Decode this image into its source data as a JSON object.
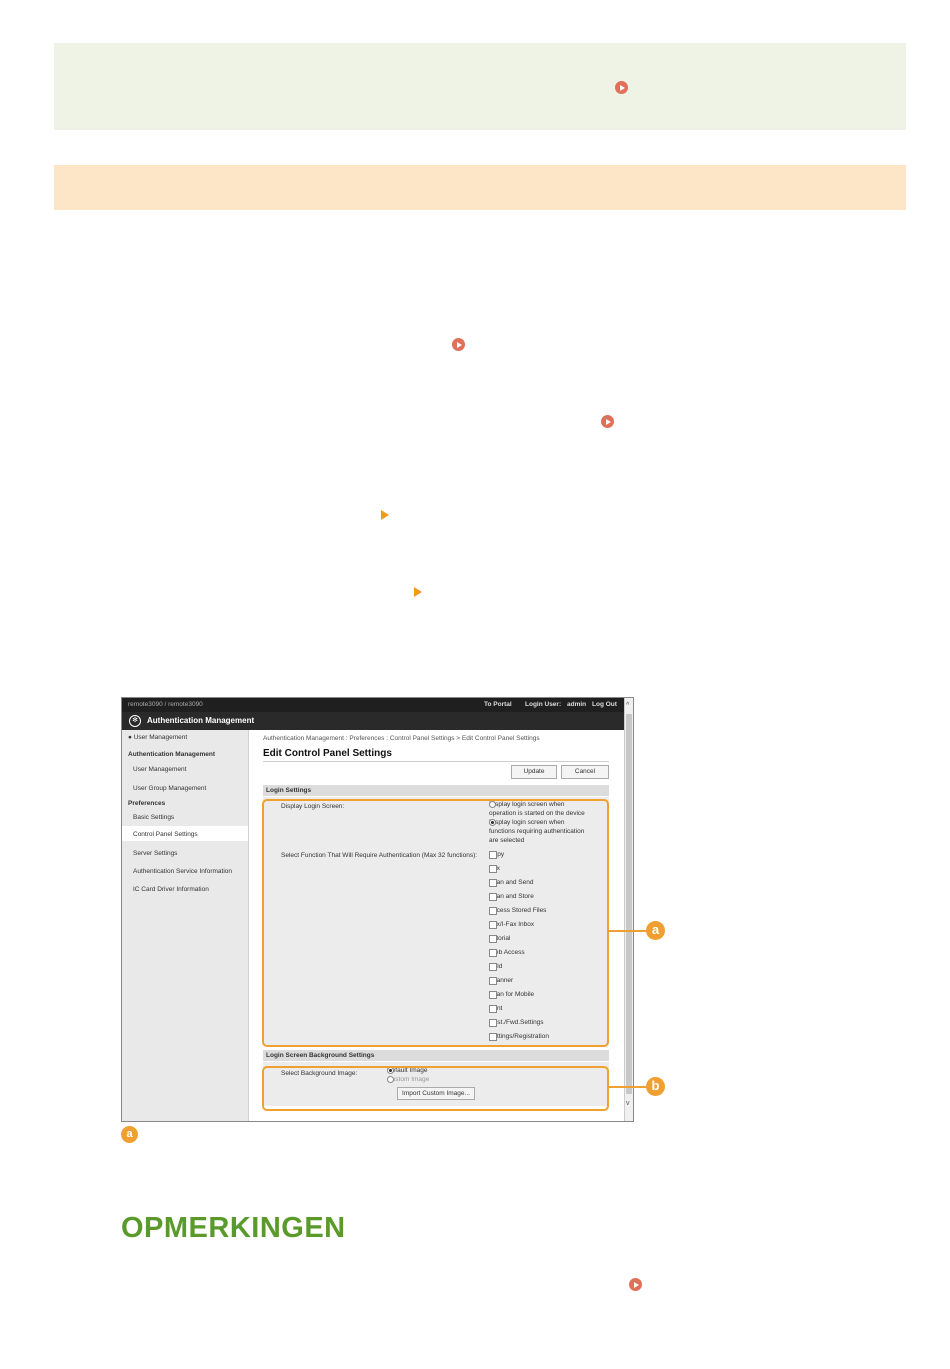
{
  "heading": "OPMERKINGEN",
  "icons": {
    "link": "circle-play-icon",
    "step": "triangle-arrow-icon"
  },
  "colors": {
    "note_bg": "#eef3e6",
    "caution_bg": "#fde6c7",
    "link_icon": "#e0705a",
    "callout": "#f0a030",
    "heading": "#5a9a2a"
  },
  "screenshot": {
    "top_left_text": "remote3090 / remote3090",
    "to_portal": "To Portal",
    "login_user_label": "Login User:",
    "login_user": "admin",
    "log_out": "Log Out",
    "app_title": "Authentication Management",
    "breadcrumb": "Authentication Management : Preferences : Control Panel Settings > Edit Control Panel Settings",
    "page_title": "Edit Control Panel Settings",
    "update_button": "Update",
    "cancel_button": "Cancel",
    "sidebar": {
      "top_link": "User Management",
      "group_1": "Authentication Management",
      "item_user_mgmt": "User Management",
      "item_group_mgmt": "User Group Management",
      "group_2": "Preferences",
      "item_basic": "Basic Settings",
      "item_control_panel": "Control Panel Settings",
      "item_server": "Server Settings",
      "item_auth_service": "Authentication Service Information",
      "item_ic_card": "IC Card Driver Information"
    },
    "login_settings": {
      "header": "Login Settings",
      "display_label": "Display Login Screen:",
      "radio_1_line1": "Display login screen when",
      "radio_1_line2": "operation is started on the device",
      "radio_2_line1": "Display login screen when",
      "radio_2_line2": "functions requiring authentication",
      "radio_2_line3": "are selected",
      "functions_label": "Select Function That Will Require Authentication (Max 32 functions):",
      "functions": [
        "Copy",
        "Fax",
        "Scan and Send",
        "Scan and Store",
        "Access Stored Files",
        "Fax/I-Fax Inbox",
        "Tutorial",
        "Web Access",
        "Hold",
        "Scanner",
        "Scan for Mobile",
        "Print",
        "Dest./Fwd.Settings",
        "Settings/Registration"
      ]
    },
    "bg_settings": {
      "header": "Login Screen Background Settings",
      "select_label": "Select Background Image:",
      "default_image": "Default Image",
      "custom_image": "Custom Image",
      "import_button": "Import Custom Image..."
    }
  },
  "callouts": {
    "a": "a",
    "b": "b"
  }
}
